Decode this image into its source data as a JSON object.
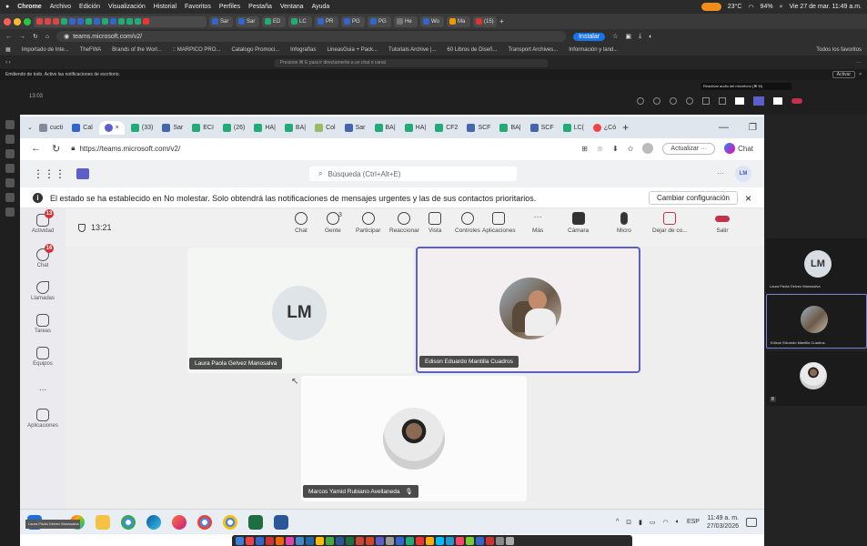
{
  "mac_menu": {
    "items": [
      "Chrome",
      "Archivo",
      "Edición",
      "Visualización",
      "Historial",
      "Favoritos",
      "Perfiles",
      "Pestaña",
      "Ventana",
      "Ayuda"
    ],
    "weather": "23°C",
    "battery": "94%",
    "datetime": "Vie 27 de mar. 11:49 a.m."
  },
  "outer_browser": {
    "url": "teams.microsoft.com/v2/",
    "install_label": "Instalar",
    "bookmarks": [
      "Importado de Inte...",
      "TheFWA",
      "Brands of the Worl...",
      ":: MARPICO PRO...",
      "Catalogo Promoci...",
      "Infografías",
      "LineasGuia + Pack...",
      "Tutorials Archive |...",
      "60 Libros de Diseñ...",
      "Transport Archives...",
      "Información y land..."
    ],
    "all_bookmarks": "Todos los favoritos",
    "tabs": [
      "Sar",
      "Sar",
      "ED",
      "LC",
      "PR",
      "PG",
      "PG",
      "He",
      "Wo",
      "Ma",
      "(15)"
    ]
  },
  "outer_teams": {
    "search_placeholder": "Presione ⌘ E para ir directamente a un chat o canal",
    "notice": "Emitiendo de todo. Active las notificaciones de escritorio.",
    "activate": "Activar",
    "call_time": "13:03",
    "tooltip": "Reactivar audio del micrófono (⌘ M)",
    "side_participants": [
      {
        "initials": "LM",
        "name": "Laura Paola Gelvez Manosalva"
      },
      {
        "name": "Edison Eduardo Mantilla Cuadros"
      },
      {
        "badge": "8"
      }
    ]
  },
  "inner_browser": {
    "tabs": [
      "cucti",
      "Cal",
      "",
      "(33)",
      "Sar",
      "ECI",
      "(26)",
      "HA|",
      "BA|",
      "Col",
      "Sar",
      "BA|",
      "HA|",
      "CF2",
      "SCF",
      "BA|",
      "SCF",
      "LC(",
      "¿Có"
    ],
    "url": "https://teams.microsoft.com/v2/",
    "update_label": "Actualizar",
    "chat_label": "Chat"
  },
  "teams": {
    "search_placeholder": "Búsqueda (Ctrl+Alt+E)",
    "avatar_initials": "LM",
    "dnd_message": "El estado se ha establecido en No molestar. Solo obtendrá las notificaciones de mensajes urgentes y las de sus contactos prioritarios.",
    "change_config": "Cambiar configuración",
    "nav": [
      {
        "label": "Actividad",
        "badge": "13"
      },
      {
        "label": "Chat",
        "badge": "16"
      },
      {
        "label": "Llamadas"
      },
      {
        "label": "Tareas"
      },
      {
        "label": "Equipos"
      },
      {
        "label": "..."
      },
      {
        "label": "Aplicaciones"
      }
    ],
    "call": {
      "time": "13:21",
      "people_count": "3",
      "controls": [
        "Chat",
        "Gente",
        "Participar",
        "Reaccionar",
        "Vista",
        "Controles",
        "Aplicaciones",
        "Más",
        "Cámara",
        "Micro",
        "Dejar de co...",
        "Salir"
      ]
    },
    "participants": [
      {
        "initials": "LM",
        "name": "Laura Paola Gelvez Manosalva"
      },
      {
        "name": "Edison Eduardo Mantilla Cuadros"
      },
      {
        "name": "Marcos Yamid Rubiano Avellaneda"
      }
    ]
  },
  "taskbar": {
    "lang": "ESP",
    "time": "11:49 a. m.",
    "date": "27/03/2026",
    "preview_label": "Laura Paola Gelvez Manosalva"
  }
}
